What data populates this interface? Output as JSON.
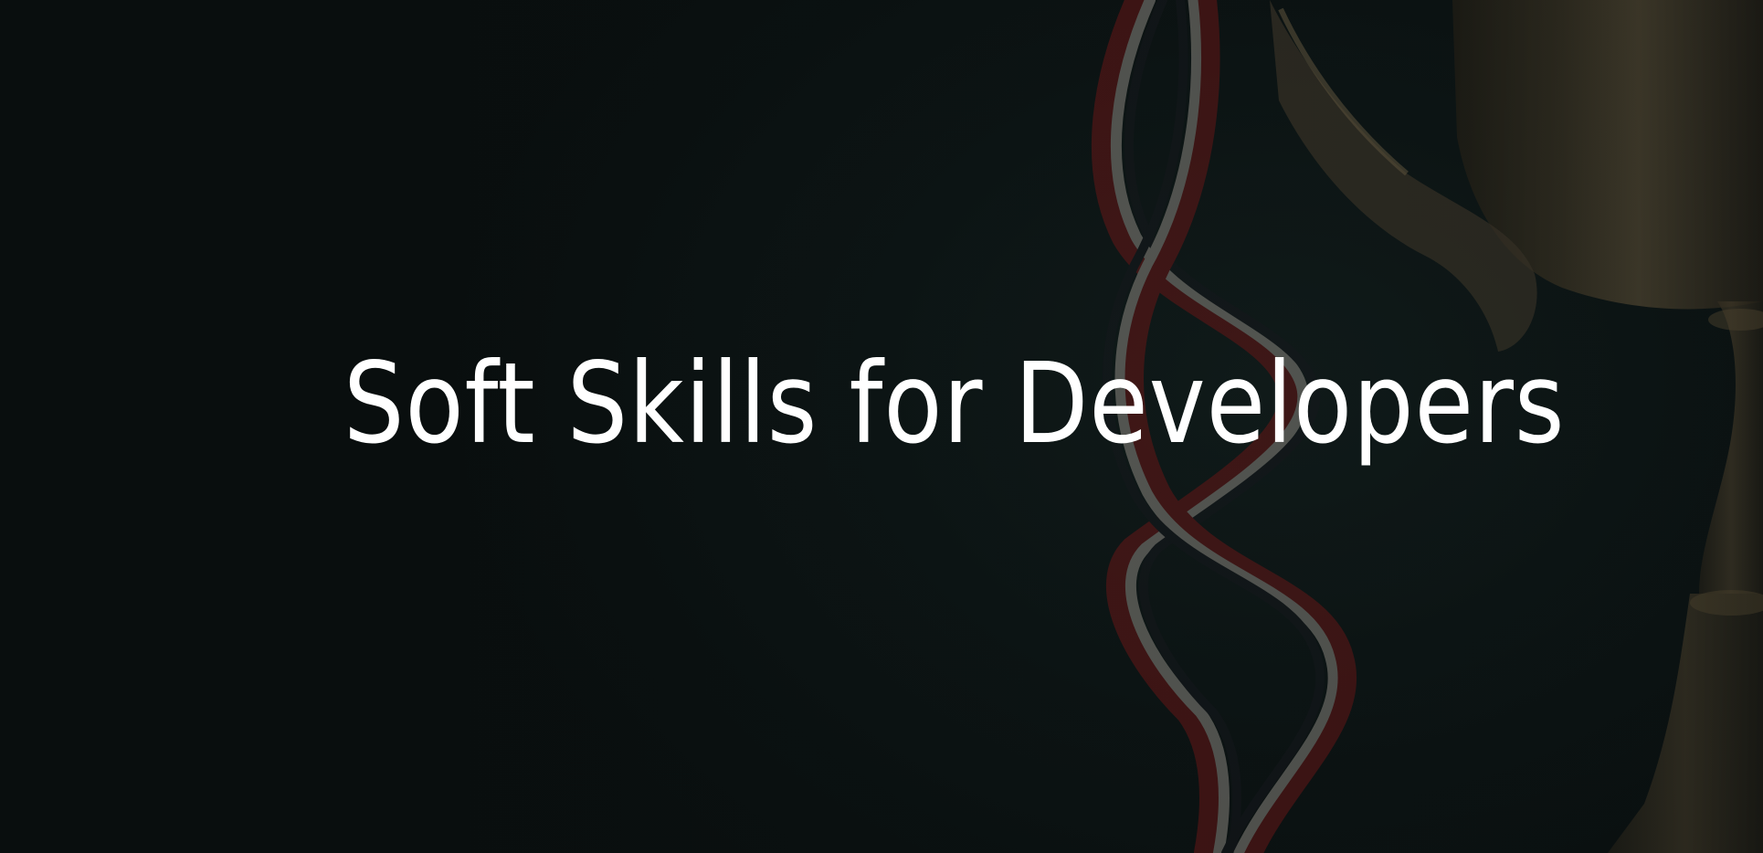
{
  "hero": {
    "title": "Soft Skills for Developers",
    "background_color": "#0b1414",
    "title_color": "#ffffff",
    "background_image": "trophy-and-ribbon-photo"
  }
}
